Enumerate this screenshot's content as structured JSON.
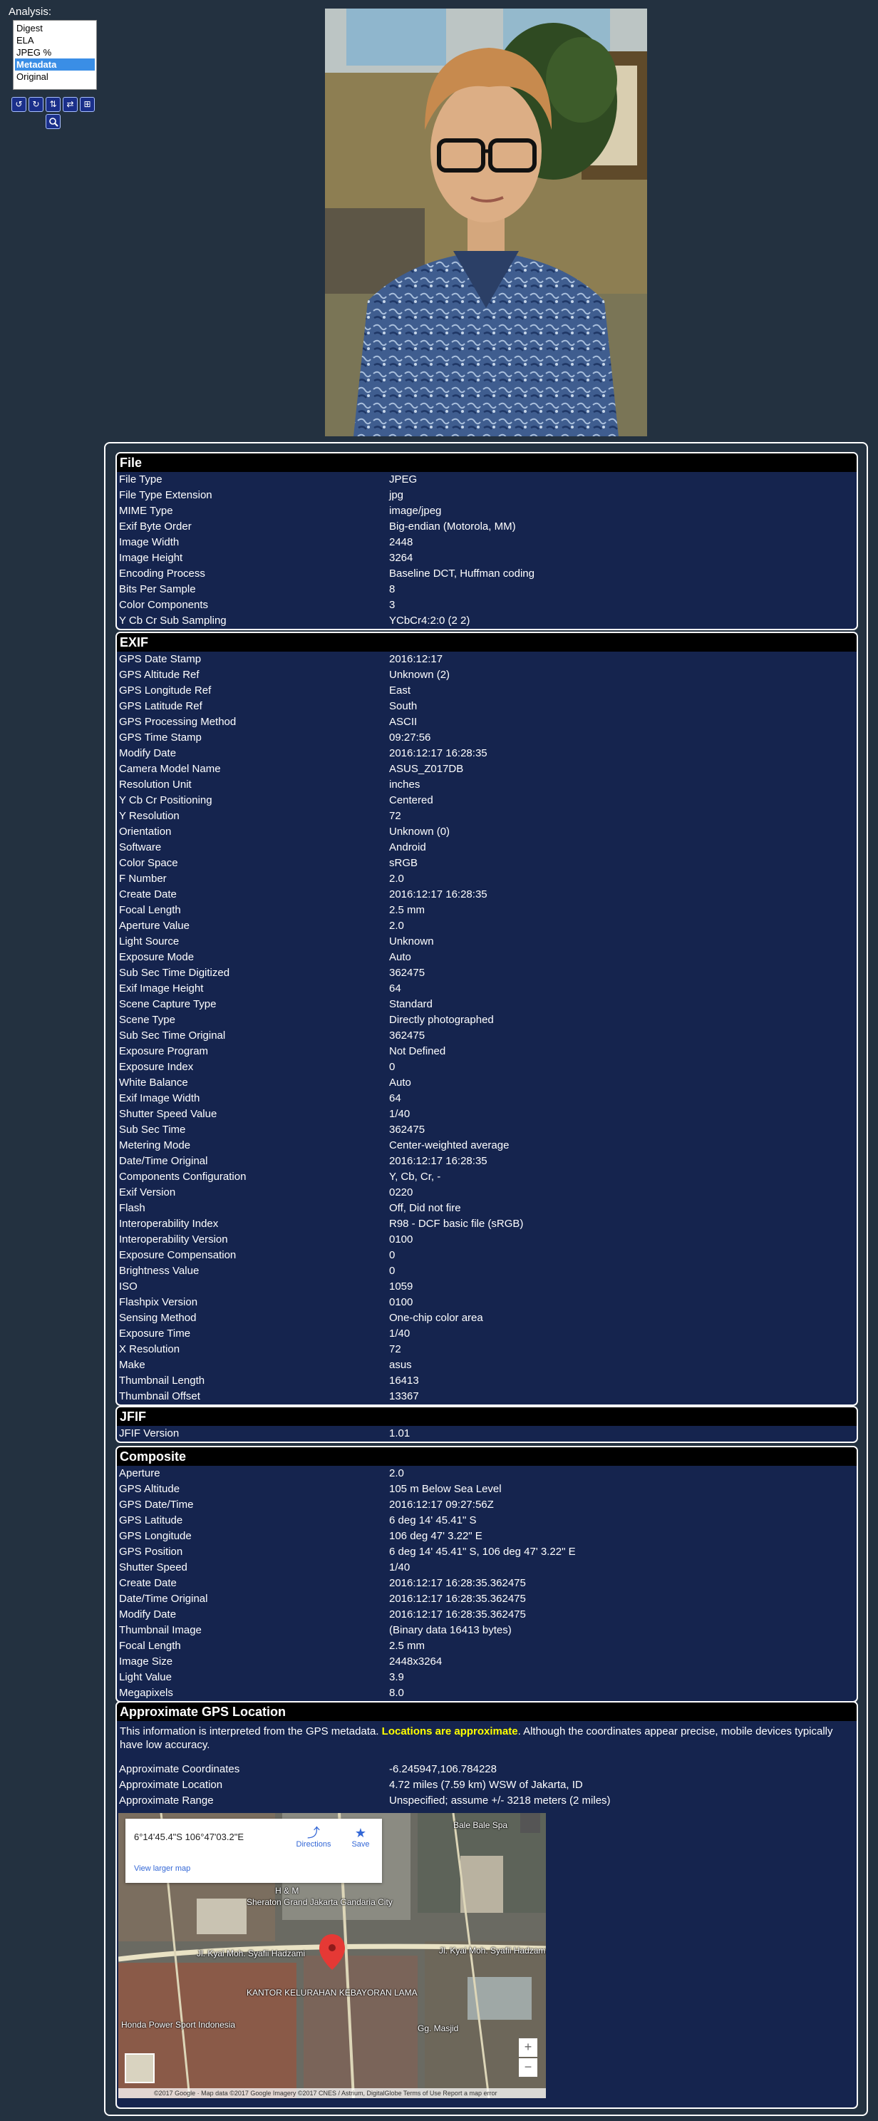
{
  "analysis": {
    "label": "Analysis:",
    "options": [
      "Digest",
      "ELA",
      "JPEG %",
      "Metadata",
      "Original"
    ],
    "selected": "Metadata"
  },
  "toolbar": {
    "buttons": [
      {
        "name": "rotate-left-icon",
        "glyph": "↺"
      },
      {
        "name": "rotate-right-icon",
        "glyph": "↻"
      },
      {
        "name": "flip-vertical-icon",
        "glyph": "⇅"
      },
      {
        "name": "flip-horizontal-icon",
        "glyph": "⇄"
      },
      {
        "name": "expand-icon",
        "glyph": "⊞"
      }
    ],
    "zoom": {
      "name": "magnifier-icon",
      "glyph": "🔍"
    }
  },
  "sections": [
    {
      "title": "File",
      "rows": [
        [
          "File Type",
          "JPEG"
        ],
        [
          "File Type Extension",
          "jpg"
        ],
        [
          "MIME Type",
          "image/jpeg"
        ],
        [
          "Exif Byte Order",
          "Big-endian (Motorola, MM)"
        ],
        [
          "Image Width",
          "2448"
        ],
        [
          "Image Height",
          "3264"
        ],
        [
          "Encoding Process",
          "Baseline DCT, Huffman coding"
        ],
        [
          "Bits Per Sample",
          "8"
        ],
        [
          "Color Components",
          "3"
        ],
        [
          "Y Cb Cr Sub Sampling",
          "YCbCr4:2:0 (2 2)"
        ]
      ]
    },
    {
      "title": "EXIF",
      "rows": [
        [
          "GPS Date Stamp",
          "2016:12:17"
        ],
        [
          "GPS Altitude Ref",
          "Unknown (2)"
        ],
        [
          "GPS Longitude Ref",
          "East"
        ],
        [
          "GPS Latitude Ref",
          "South"
        ],
        [
          "GPS Processing Method",
          "ASCII"
        ],
        [
          "GPS Time Stamp",
          "09:27:56"
        ],
        [
          "Modify Date",
          "2016:12:17 16:28:35"
        ],
        [
          "Camera Model Name",
          "ASUS_Z017DB"
        ],
        [
          "Resolution Unit",
          "inches"
        ],
        [
          "Y Cb Cr Positioning",
          "Centered"
        ],
        [
          "Y Resolution",
          "72"
        ],
        [
          "Orientation",
          "Unknown (0)"
        ],
        [
          "Software",
          "Android"
        ],
        [
          "Color Space",
          "sRGB"
        ],
        [
          "F Number",
          "2.0"
        ],
        [
          "Create Date",
          "2016:12:17 16:28:35"
        ],
        [
          "Focal Length",
          "2.5 mm"
        ],
        [
          "Aperture Value",
          "2.0"
        ],
        [
          "Light Source",
          "Unknown"
        ],
        [
          "Exposure Mode",
          "Auto"
        ],
        [
          "Sub Sec Time Digitized",
          "362475"
        ],
        [
          "Exif Image Height",
          "64"
        ],
        [
          "Scene Capture Type",
          "Standard"
        ],
        [
          "Scene Type",
          "Directly photographed"
        ],
        [
          "Sub Sec Time Original",
          "362475"
        ],
        [
          "Exposure Program",
          "Not Defined"
        ],
        [
          "Exposure Index",
          "0"
        ],
        [
          "White Balance",
          "Auto"
        ],
        [
          "Exif Image Width",
          "64"
        ],
        [
          "Shutter Speed Value",
          "1/40"
        ],
        [
          "Sub Sec Time",
          "362475"
        ],
        [
          "Metering Mode",
          "Center-weighted average"
        ],
        [
          "Date/Time Original",
          "2016:12:17 16:28:35"
        ],
        [
          "Components Configuration",
          "Y, Cb, Cr, -"
        ],
        [
          "Exif Version",
          "0220"
        ],
        [
          "Flash",
          "Off, Did not fire"
        ],
        [
          "Interoperability Index",
          "R98 - DCF basic file (sRGB)"
        ],
        [
          "Interoperability Version",
          "0100"
        ],
        [
          "Exposure Compensation",
          "0"
        ],
        [
          "Brightness Value",
          "0"
        ],
        [
          "ISO",
          "1059"
        ],
        [
          "Flashpix Version",
          "0100"
        ],
        [
          "Sensing Method",
          "One-chip color area"
        ],
        [
          "Exposure Time",
          "1/40"
        ],
        [
          "X Resolution",
          "72"
        ],
        [
          "Make",
          "asus"
        ],
        [
          "Thumbnail Length",
          "16413"
        ],
        [
          "Thumbnail Offset",
          "13367"
        ]
      ]
    },
    {
      "title": "JFIF",
      "rows": [
        [
          "JFIF Version",
          "1.01"
        ]
      ]
    },
    {
      "title": "Composite",
      "rows": [
        [
          "Aperture",
          "2.0"
        ],
        [
          "GPS Altitude",
          "105 m Below Sea Level"
        ],
        [
          "GPS Date/Time",
          "2016:12:17 09:27:56Z"
        ],
        [
          "GPS Latitude",
          "6 deg 14' 45.41\" S"
        ],
        [
          "GPS Longitude",
          "106 deg 47' 3.22\" E"
        ],
        [
          "GPS Position",
          "6 deg 14' 45.41\" S, 106 deg 47' 3.22\" E"
        ],
        [
          "Shutter Speed",
          "1/40"
        ],
        [
          "Create Date",
          "2016:12:17 16:28:35.362475"
        ],
        [
          "Date/Time Original",
          "2016:12:17 16:28:35.362475"
        ],
        [
          "Modify Date",
          "2016:12:17 16:28:35.362475"
        ],
        [
          "Thumbnail Image",
          "(Binary data 16413 bytes)"
        ],
        [
          "Focal Length",
          "2.5 mm"
        ],
        [
          "Image Size",
          "2448x3264"
        ],
        [
          "Light Value",
          "3.9"
        ],
        [
          "Megapixels",
          "8.0"
        ]
      ]
    }
  ],
  "gps": {
    "title": "Approximate GPS Location",
    "note_before": "This information is interpreted from the GPS metadata. ",
    "note_highlight": "Locations are approximate",
    "note_after": ". Although the coordinates appear precise, mobile devices typically have low accuracy.",
    "rows": [
      [
        "Approximate Coordinates",
        "-6.245947,106.784228"
      ],
      [
        "Approximate Location",
        "4.72 miles (7.59 km) WSW of Jakarta, ID"
      ],
      [
        "Approximate Range",
        "Unspecified; assume +/- 3218 meters (2 miles)"
      ]
    ],
    "map": {
      "card_coords": "6°14'45.4\"S 106°47'03.2\"E",
      "directions": "Directions",
      "save": "Save",
      "view_larger": "View larger map",
      "labels": [
        "Bale Bale Spa",
        "H & M",
        "Sheraton Grand Jakarta Gandaria City",
        "Jl. Kyai Moh. Syafii Hadzami",
        "Jl. Kyai Moh. Syafii Hadzami",
        "KANTOR KELURAHAN KEBAYORAN LAMA",
        "Honda Power Sport Indonesia",
        "Gg. Masjid"
      ],
      "attribution": "©2017 Google · Map data ©2017 Google Imagery ©2017 CNES / Astrium, DigitalGlobe   Terms of Use   Report a map error",
      "zoom_in": "+",
      "zoom_out": "−"
    }
  }
}
